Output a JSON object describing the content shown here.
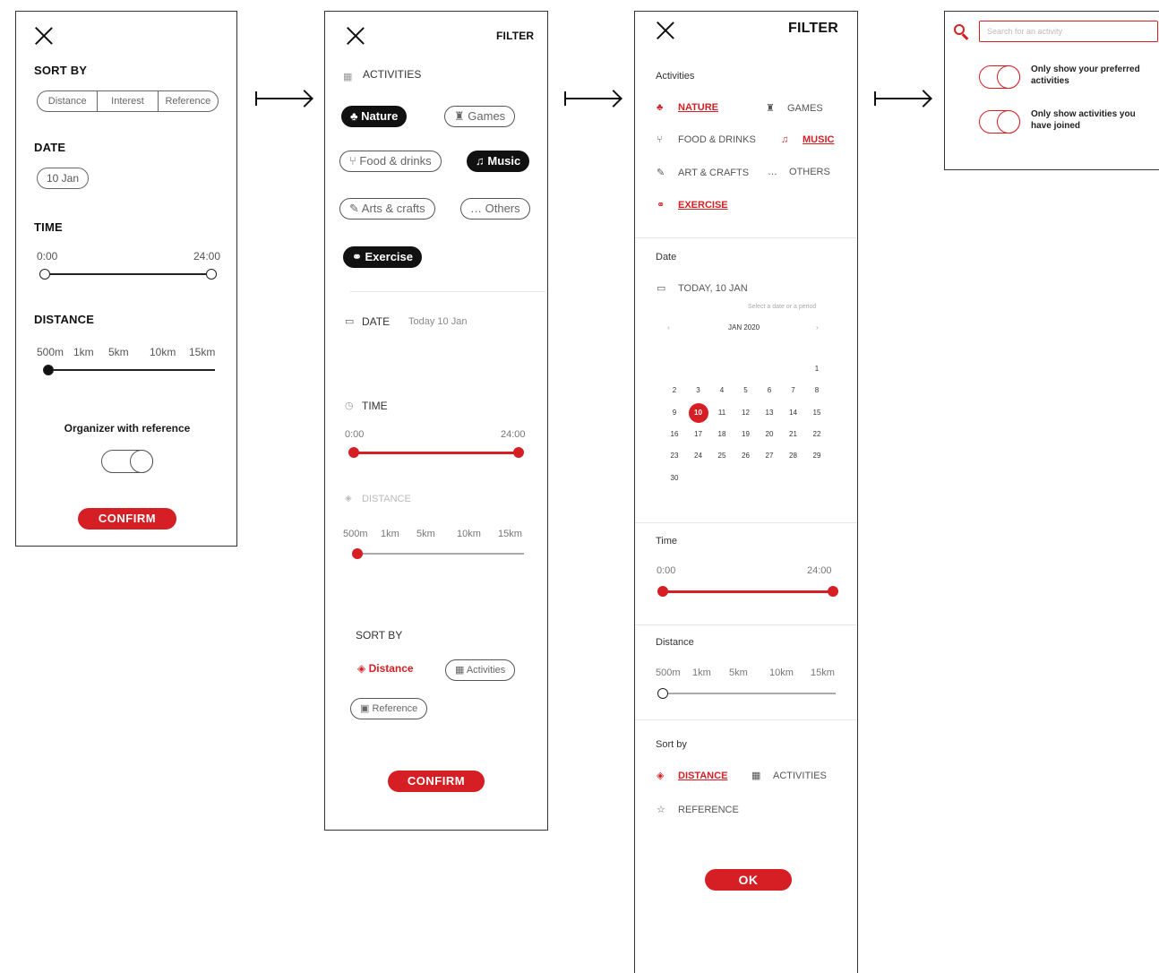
{
  "screen1": {
    "sort_by_title": "SORT BY",
    "sort_options": [
      "Distance",
      "Interest",
      "Reference"
    ],
    "date_title": "DATE",
    "date_value": "10 Jan",
    "time_title": "TIME",
    "time_start": "0:00",
    "time_end": "24:00",
    "distance_title": "DISTANCE",
    "distance_ticks": [
      "500m",
      "1km",
      "5km",
      "10km",
      "15km"
    ],
    "organizer_label": "Organizer with reference",
    "confirm_label": "CONFIRM"
  },
  "screen2": {
    "filter_title": "FILTER",
    "activities_title": "ACTIVITIES",
    "chips": [
      {
        "label": "Nature",
        "icon": "🞿",
        "selected": true
      },
      {
        "label": "Games",
        "icon": "♜",
        "selected": false
      },
      {
        "label": "Food & drinks",
        "icon": "🍴",
        "selected": false
      },
      {
        "label": "Music",
        "icon": "♫",
        "selected": true
      },
      {
        "label": "Arts & crafts",
        "icon": "✎",
        "selected": false
      },
      {
        "label": "Others",
        "icon": "…",
        "selected": false
      },
      {
        "label": "Exercise",
        "icon": "⚭",
        "selected": true
      }
    ],
    "date_title": "DATE",
    "date_value": "Today 10 Jan",
    "time_title": "TIME",
    "time_start": "0:00",
    "time_end": "24:00",
    "distance_title": "DISTANCE",
    "distance_ticks": [
      "500m",
      "1km",
      "5km",
      "10km",
      "15km"
    ],
    "sort_by_title": "SORT BY",
    "sort_distance": "Distance",
    "sort_activities": "Activities",
    "sort_reference": "Reference",
    "confirm_label": "CONFIRM"
  },
  "screen3": {
    "filter_title": "FILTER",
    "activities_title": "Activities",
    "categories": {
      "nature": "NATURE",
      "games": "GAMES",
      "food": "FOOD & DRINKS",
      "music": "MUSIC",
      "arts": "ART & CRAFTS",
      "others": "OTHERS",
      "exercise": "EXERCISE"
    },
    "date_title": "Date",
    "date_value": "TODAY, 10 JAN",
    "date_hint": "Select a date or a period",
    "calendar_month": "JAN 2020",
    "calendar_rows": [
      [
        "",
        "",
        "",
        "",
        "",
        "",
        "1"
      ],
      [
        "2",
        "3",
        "4",
        "5",
        "6",
        "7",
        "8"
      ],
      [
        "9",
        "10",
        "11",
        "12",
        "13",
        "14",
        "15"
      ],
      [
        "16",
        "17",
        "18",
        "19",
        "20",
        "21",
        "22"
      ],
      [
        "23",
        "24",
        "25",
        "26",
        "27",
        "28",
        "29"
      ],
      [
        "30",
        "",
        "",
        "",
        "",
        "",
        ""
      ]
    ],
    "selected_day": "10",
    "time_title": "Time",
    "time_start": "0:00",
    "time_end": "24:00",
    "distance_title": "Distance",
    "distance_ticks": [
      "500m",
      "1km",
      "5km",
      "10km",
      "15km"
    ],
    "sort_by_title": "Sort by",
    "sort_distance": "DISTANCE",
    "sort_activities": "ACTIVITIES",
    "sort_reference": "REFERENCE",
    "ok_label": "OK"
  },
  "screen4": {
    "search_placeholder": "Search for an activity",
    "toggle1_label": "Only show your preferred activities",
    "toggle2_label": "Only show activities you have joined"
  },
  "colors": {
    "accent": "#d51f24",
    "ink": "#111111"
  }
}
